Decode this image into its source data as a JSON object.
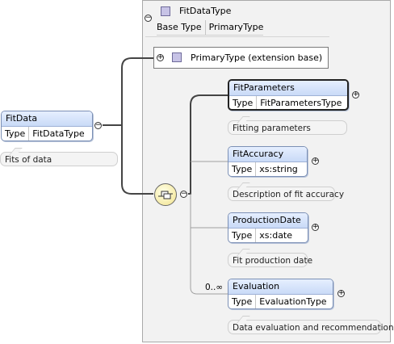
{
  "root": {
    "name": "FitData",
    "type_label": "Type",
    "type_value": "FitDataType",
    "annotation": "Fits of data"
  },
  "complex_type": {
    "name": "FitDataType",
    "base_label": "Base Type",
    "base_value": "PrimaryType",
    "extension_label": "PrimaryType (extension base)"
  },
  "children": [
    {
      "name": "FitParameters",
      "type_label": "Type",
      "type_value": "FitParametersType",
      "annotation": "Fitting parameters",
      "occurs": ""
    },
    {
      "name": "FitAccuracy",
      "type_label": "Type",
      "type_value": "xs:string",
      "annotation": "Description of fit accuracy",
      "occurs": ""
    },
    {
      "name": "ProductionDate",
      "type_label": "Type",
      "type_value": "xs:date",
      "annotation": "Fit production date",
      "occurs": ""
    },
    {
      "name": "Evaluation",
      "type_label": "Type",
      "type_value": "EvaluationType",
      "annotation": "Data evaluation and recommendation",
      "occurs": "0..∞"
    }
  ],
  "icons": {
    "toggle_collapse": "−",
    "toggle_expand": "+"
  }
}
